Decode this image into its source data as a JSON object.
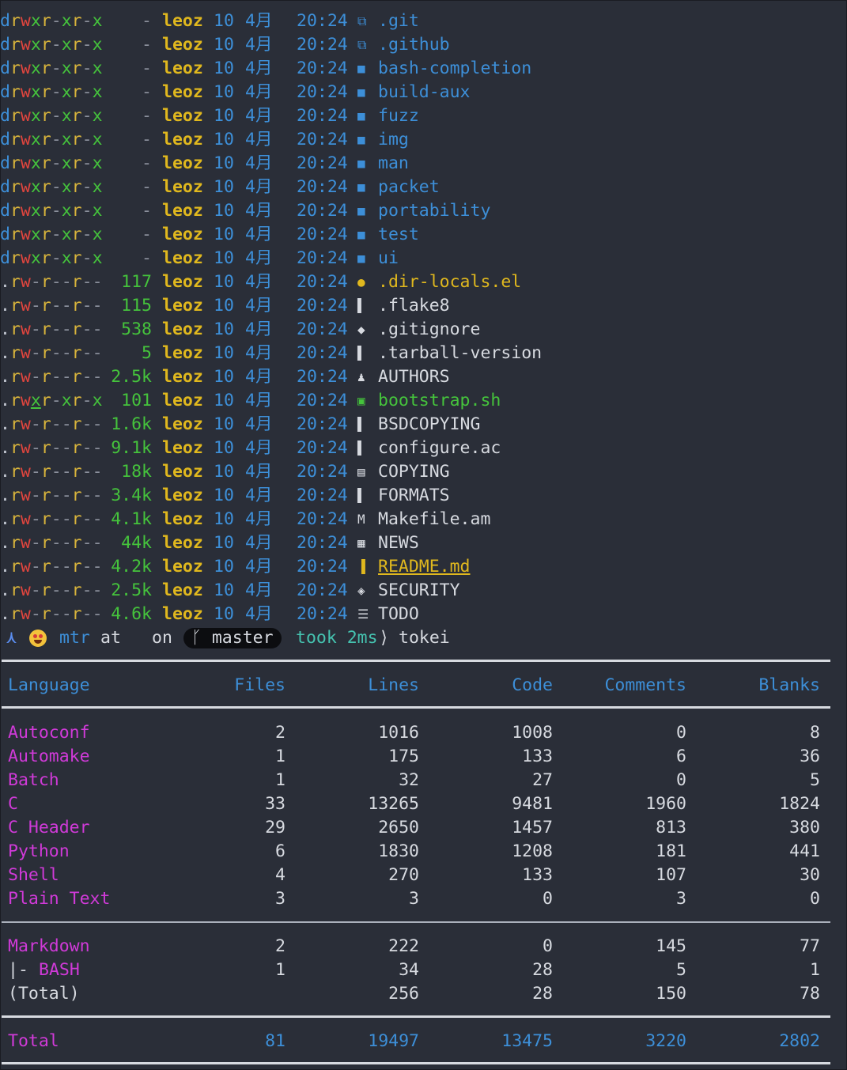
{
  "ls_rows": [
    {
      "type": "d",
      "perms": [
        "d",
        "r",
        "w",
        "x",
        "r",
        "-",
        "x",
        "r",
        "-",
        "x"
      ],
      "size": "-",
      "user": "leoz",
      "day": "10",
      "month": "4月",
      "time": "20:24",
      "icon": "git-folder-icon",
      "glyph": "⧉",
      "name": ".git",
      "kind": "dir"
    },
    {
      "type": "d",
      "perms": [
        "d",
        "r",
        "w",
        "x",
        "r",
        "-",
        "x",
        "r",
        "-",
        "x"
      ],
      "size": "-",
      "user": "leoz",
      "day": "10",
      "month": "4月",
      "time": "20:24",
      "icon": "github-folder-icon",
      "glyph": "⧉",
      "name": ".github",
      "kind": "dir"
    },
    {
      "type": "d",
      "perms": [
        "d",
        "r",
        "w",
        "x",
        "r",
        "-",
        "x",
        "r",
        "-",
        "x"
      ],
      "size": "-",
      "user": "leoz",
      "day": "10",
      "month": "4月",
      "time": "20:24",
      "icon": "folder-icon",
      "glyph": "■",
      "name": "bash-completion",
      "kind": "dir"
    },
    {
      "type": "d",
      "perms": [
        "d",
        "r",
        "w",
        "x",
        "r",
        "-",
        "x",
        "r",
        "-",
        "x"
      ],
      "size": "-",
      "user": "leoz",
      "day": "10",
      "month": "4月",
      "time": "20:24",
      "icon": "folder-icon",
      "glyph": "■",
      "name": "build-aux",
      "kind": "dir"
    },
    {
      "type": "d",
      "perms": [
        "d",
        "r",
        "w",
        "x",
        "r",
        "-",
        "x",
        "r",
        "-",
        "x"
      ],
      "size": "-",
      "user": "leoz",
      "day": "10",
      "month": "4月",
      "time": "20:24",
      "icon": "folder-icon",
      "glyph": "■",
      "name": "fuzz",
      "kind": "dir"
    },
    {
      "type": "d",
      "perms": [
        "d",
        "r",
        "w",
        "x",
        "r",
        "-",
        "x",
        "r",
        "-",
        "x"
      ],
      "size": "-",
      "user": "leoz",
      "day": "10",
      "month": "4月",
      "time": "20:24",
      "icon": "folder-icon",
      "glyph": "■",
      "name": "img",
      "kind": "dir"
    },
    {
      "type": "d",
      "perms": [
        "d",
        "r",
        "w",
        "x",
        "r",
        "-",
        "x",
        "r",
        "-",
        "x"
      ],
      "size": "-",
      "user": "leoz",
      "day": "10",
      "month": "4月",
      "time": "20:24",
      "icon": "folder-icon",
      "glyph": "■",
      "name": "man",
      "kind": "dir"
    },
    {
      "type": "d",
      "perms": [
        "d",
        "r",
        "w",
        "x",
        "r",
        "-",
        "x",
        "r",
        "-",
        "x"
      ],
      "size": "-",
      "user": "leoz",
      "day": "10",
      "month": "4月",
      "time": "20:24",
      "icon": "folder-icon",
      "glyph": "■",
      "name": "packet",
      "kind": "dir"
    },
    {
      "type": "d",
      "perms": [
        "d",
        "r",
        "w",
        "x",
        "r",
        "-",
        "x",
        "r",
        "-",
        "x"
      ],
      "size": "-",
      "user": "leoz",
      "day": "10",
      "month": "4月",
      "time": "20:24",
      "icon": "folder-icon",
      "glyph": "■",
      "name": "portability",
      "kind": "dir"
    },
    {
      "type": "d",
      "perms": [
        "d",
        "r",
        "w",
        "x",
        "r",
        "-",
        "x",
        "r",
        "-",
        "x"
      ],
      "size": "-",
      "user": "leoz",
      "day": "10",
      "month": "4月",
      "time": "20:24",
      "icon": "folder-icon",
      "glyph": "■",
      "name": "test",
      "kind": "dir"
    },
    {
      "type": "d",
      "perms": [
        "d",
        "r",
        "w",
        "x",
        "r",
        "-",
        "x",
        "r",
        "-",
        "x"
      ],
      "size": "-",
      "user": "leoz",
      "day": "10",
      "month": "4月",
      "time": "20:24",
      "icon": "folder-icon",
      "glyph": "■",
      "name": "ui",
      "kind": "dir"
    },
    {
      "type": "f",
      "perms": [
        ".",
        "r",
        "w",
        "-",
        "r",
        "-",
        "-",
        "r",
        "-",
        "-"
      ],
      "size": "117",
      "user": "leoz",
      "day": "10",
      "month": "4月",
      "time": "20:24",
      "icon": "emacs-icon",
      "glyph": "●",
      "name": ".dir-locals.el",
      "kind": "yellow"
    },
    {
      "type": "f",
      "perms": [
        ".",
        "r",
        "w",
        "-",
        "r",
        "-",
        "-",
        "r",
        "-",
        "-"
      ],
      "size": "115",
      "user": "leoz",
      "day": "10",
      "month": "4月",
      "time": "20:24",
      "icon": "file-icon",
      "glyph": "▌",
      "name": ".flake8",
      "kind": "file"
    },
    {
      "type": "f",
      "perms": [
        ".",
        "r",
        "w",
        "-",
        "r",
        "-",
        "-",
        "r",
        "-",
        "-"
      ],
      "size": "538",
      "user": "leoz",
      "day": "10",
      "month": "4月",
      "time": "20:24",
      "icon": "git-icon",
      "glyph": "◆",
      "name": ".gitignore",
      "kind": "file"
    },
    {
      "type": "f",
      "perms": [
        ".",
        "r",
        "w",
        "-",
        "r",
        "-",
        "-",
        "r",
        "-",
        "-"
      ],
      "size": "5",
      "user": "leoz",
      "day": "10",
      "month": "4月",
      "time": "20:24",
      "icon": "file-icon",
      "glyph": "▌",
      "name": ".tarball-version",
      "kind": "file"
    },
    {
      "type": "f",
      "perms": [
        ".",
        "r",
        "w",
        "-",
        "r",
        "-",
        "-",
        "r",
        "-",
        "-"
      ],
      "size": "2.5k",
      "user": "leoz",
      "day": "10",
      "month": "4月",
      "time": "20:24",
      "icon": "users-icon",
      "glyph": "♟",
      "name": "AUTHORS",
      "kind": "file"
    },
    {
      "type": "f",
      "perms": [
        ".",
        "r",
        "w",
        "x",
        "r",
        "-",
        "x",
        "r",
        "-",
        "x"
      ],
      "size": "101",
      "user": "leoz",
      "day": "10",
      "month": "4月",
      "time": "20:24",
      "icon": "terminal-icon",
      "glyph": "▣",
      "name": "bootstrap.sh",
      "kind": "green"
    },
    {
      "type": "f",
      "perms": [
        ".",
        "r",
        "w",
        "-",
        "r",
        "-",
        "-",
        "r",
        "-",
        "-"
      ],
      "size": "1.6k",
      "user": "leoz",
      "day": "10",
      "month": "4月",
      "time": "20:24",
      "icon": "license-icon",
      "glyph": "▌",
      "name": "BSDCOPYING",
      "kind": "file"
    },
    {
      "type": "f",
      "perms": [
        ".",
        "r",
        "w",
        "-",
        "r",
        "-",
        "-",
        "r",
        "-",
        "-"
      ],
      "size": "9.1k",
      "user": "leoz",
      "day": "10",
      "month": "4月",
      "time": "20:24",
      "icon": "config-file-icon",
      "glyph": "▌",
      "name": "configure.ac",
      "kind": "file"
    },
    {
      "type": "f",
      "perms": [
        ".",
        "r",
        "w",
        "-",
        "r",
        "-",
        "-",
        "r",
        "-",
        "-"
      ],
      "size": "18k",
      "user": "leoz",
      "day": "10",
      "month": "4月",
      "time": "20:24",
      "icon": "book-icon",
      "glyph": "▤",
      "name": "COPYING",
      "kind": "file"
    },
    {
      "type": "f",
      "perms": [
        ".",
        "r",
        "w",
        "-",
        "r",
        "-",
        "-",
        "r",
        "-",
        "-"
      ],
      "size": "3.4k",
      "user": "leoz",
      "day": "10",
      "month": "4月",
      "time": "20:24",
      "icon": "license-icon",
      "glyph": "▌",
      "name": "FORMATS",
      "kind": "file"
    },
    {
      "type": "f",
      "perms": [
        ".",
        "r",
        "w",
        "-",
        "r",
        "-",
        "-",
        "r",
        "-",
        "-"
      ],
      "size": "4.1k",
      "user": "leoz",
      "day": "10",
      "month": "4月",
      "time": "20:24",
      "icon": "makefile-icon",
      "glyph": "M",
      "name": "Makefile.am",
      "kind": "file"
    },
    {
      "type": "f",
      "perms": [
        ".",
        "r",
        "w",
        "-",
        "r",
        "-",
        "-",
        "r",
        "-",
        "-"
      ],
      "size": "44k",
      "user": "leoz",
      "day": "10",
      "month": "4月",
      "time": "20:24",
      "icon": "news-icon",
      "glyph": "▦",
      "name": "NEWS",
      "kind": "file"
    },
    {
      "type": "f",
      "perms": [
        ".",
        "r",
        "w",
        "-",
        "r",
        "-",
        "-",
        "r",
        "-",
        "-"
      ],
      "size": "4.2k",
      "user": "leoz",
      "day": "10",
      "month": "4月",
      "time": "20:24",
      "icon": "readme-icon",
      "glyph": "▐",
      "name": "README.md",
      "kind": "readme"
    },
    {
      "type": "f",
      "perms": [
        ".",
        "r",
        "w",
        "-",
        "r",
        "-",
        "-",
        "r",
        "-",
        "-"
      ],
      "size": "2.5k",
      "user": "leoz",
      "day": "10",
      "month": "4月",
      "time": "20:24",
      "icon": "shield-icon",
      "glyph": "◈",
      "name": "SECURITY",
      "kind": "file"
    },
    {
      "type": "f",
      "perms": [
        ".",
        "r",
        "w",
        "-",
        "r",
        "-",
        "-",
        "r",
        "-",
        "-"
      ],
      "size": "4.6k",
      "user": "leoz",
      "day": "10",
      "month": "4月",
      "time": "20:24",
      "icon": "checklist-icon",
      "glyph": "☰",
      "name": "TODO",
      "kind": "file"
    }
  ],
  "prompt": {
    "arrow": "⋏",
    "host": "mtr",
    "at": "at",
    "on": "on",
    "branch_glyph": "ᚴ",
    "branch": "master",
    "took": "took 2ms",
    "chevron": "⟩",
    "command": "tokei"
  },
  "tokei": {
    "headers": [
      "Language",
      "Files",
      "Lines",
      "Code",
      "Comments",
      "Blanks"
    ],
    "rows": [
      [
        "Autoconf",
        "2",
        "1016",
        "1008",
        "0",
        "8"
      ],
      [
        "Automake",
        "1",
        "175",
        "133",
        "6",
        "36"
      ],
      [
        "Batch",
        "1",
        "32",
        "27",
        "0",
        "5"
      ],
      [
        "C",
        "33",
        "13265",
        "9481",
        "1960",
        "1824"
      ],
      [
        "C Header",
        "29",
        "2650",
        "1457",
        "813",
        "380"
      ],
      [
        "Python",
        "6",
        "1830",
        "1208",
        "181",
        "441"
      ],
      [
        "Shell",
        "4",
        "270",
        "133",
        "107",
        "30"
      ],
      [
        "Plain Text",
        "3",
        "3",
        "0",
        "3",
        "0"
      ]
    ],
    "markdown": {
      "main": [
        "Markdown",
        "2",
        "222",
        "0",
        "145",
        "77"
      ],
      "sub_prefix": "|- ",
      "sub": [
        "BASH",
        "1",
        "34",
        "28",
        "5",
        "1"
      ],
      "subtotal": [
        "(Total)",
        "",
        "256",
        "28",
        "150",
        "78"
      ]
    },
    "total": [
      "Total",
      "81",
      "19497",
      "13475",
      "3220",
      "2802"
    ]
  }
}
